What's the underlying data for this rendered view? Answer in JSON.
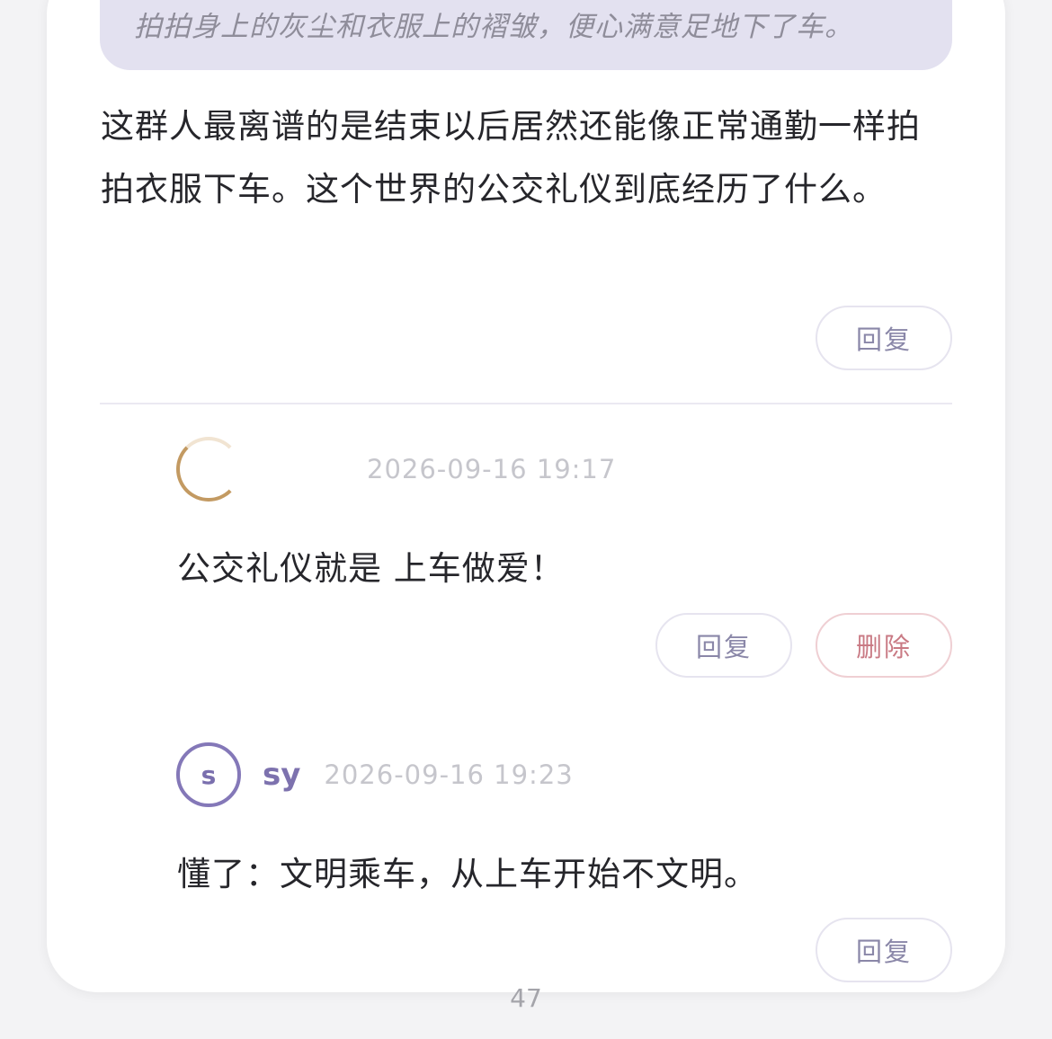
{
  "quote": {
    "text": "拍拍身上的灰尘和衣服上的褶皱，便心满意足地下了车。"
  },
  "main_comment": {
    "text": "这群人最离谱的是结束以后居然还能像正常通勤一样拍拍衣服下车。这个世界的公交礼仪到底经历了什么。",
    "reply_label": "回复"
  },
  "replies": [
    {
      "author": "",
      "avatar_letter": "",
      "time": "2026-09-16 19:17",
      "text": "公交礼仪就是 上车做爱！",
      "reply_label": "回复",
      "delete_label": "删除"
    },
    {
      "author": "sy",
      "avatar_letter": "s",
      "time": "2026-09-16 19:23",
      "text": "懂了：文明乘车，从上车开始不文明。",
      "reply_label": "回复"
    }
  ],
  "page_number": "47",
  "colors": {
    "accent": "#7d72ae",
    "quote_bg": "#e3e1f0",
    "danger": "#c97a84",
    "avatar_gold": "#c39a62"
  }
}
